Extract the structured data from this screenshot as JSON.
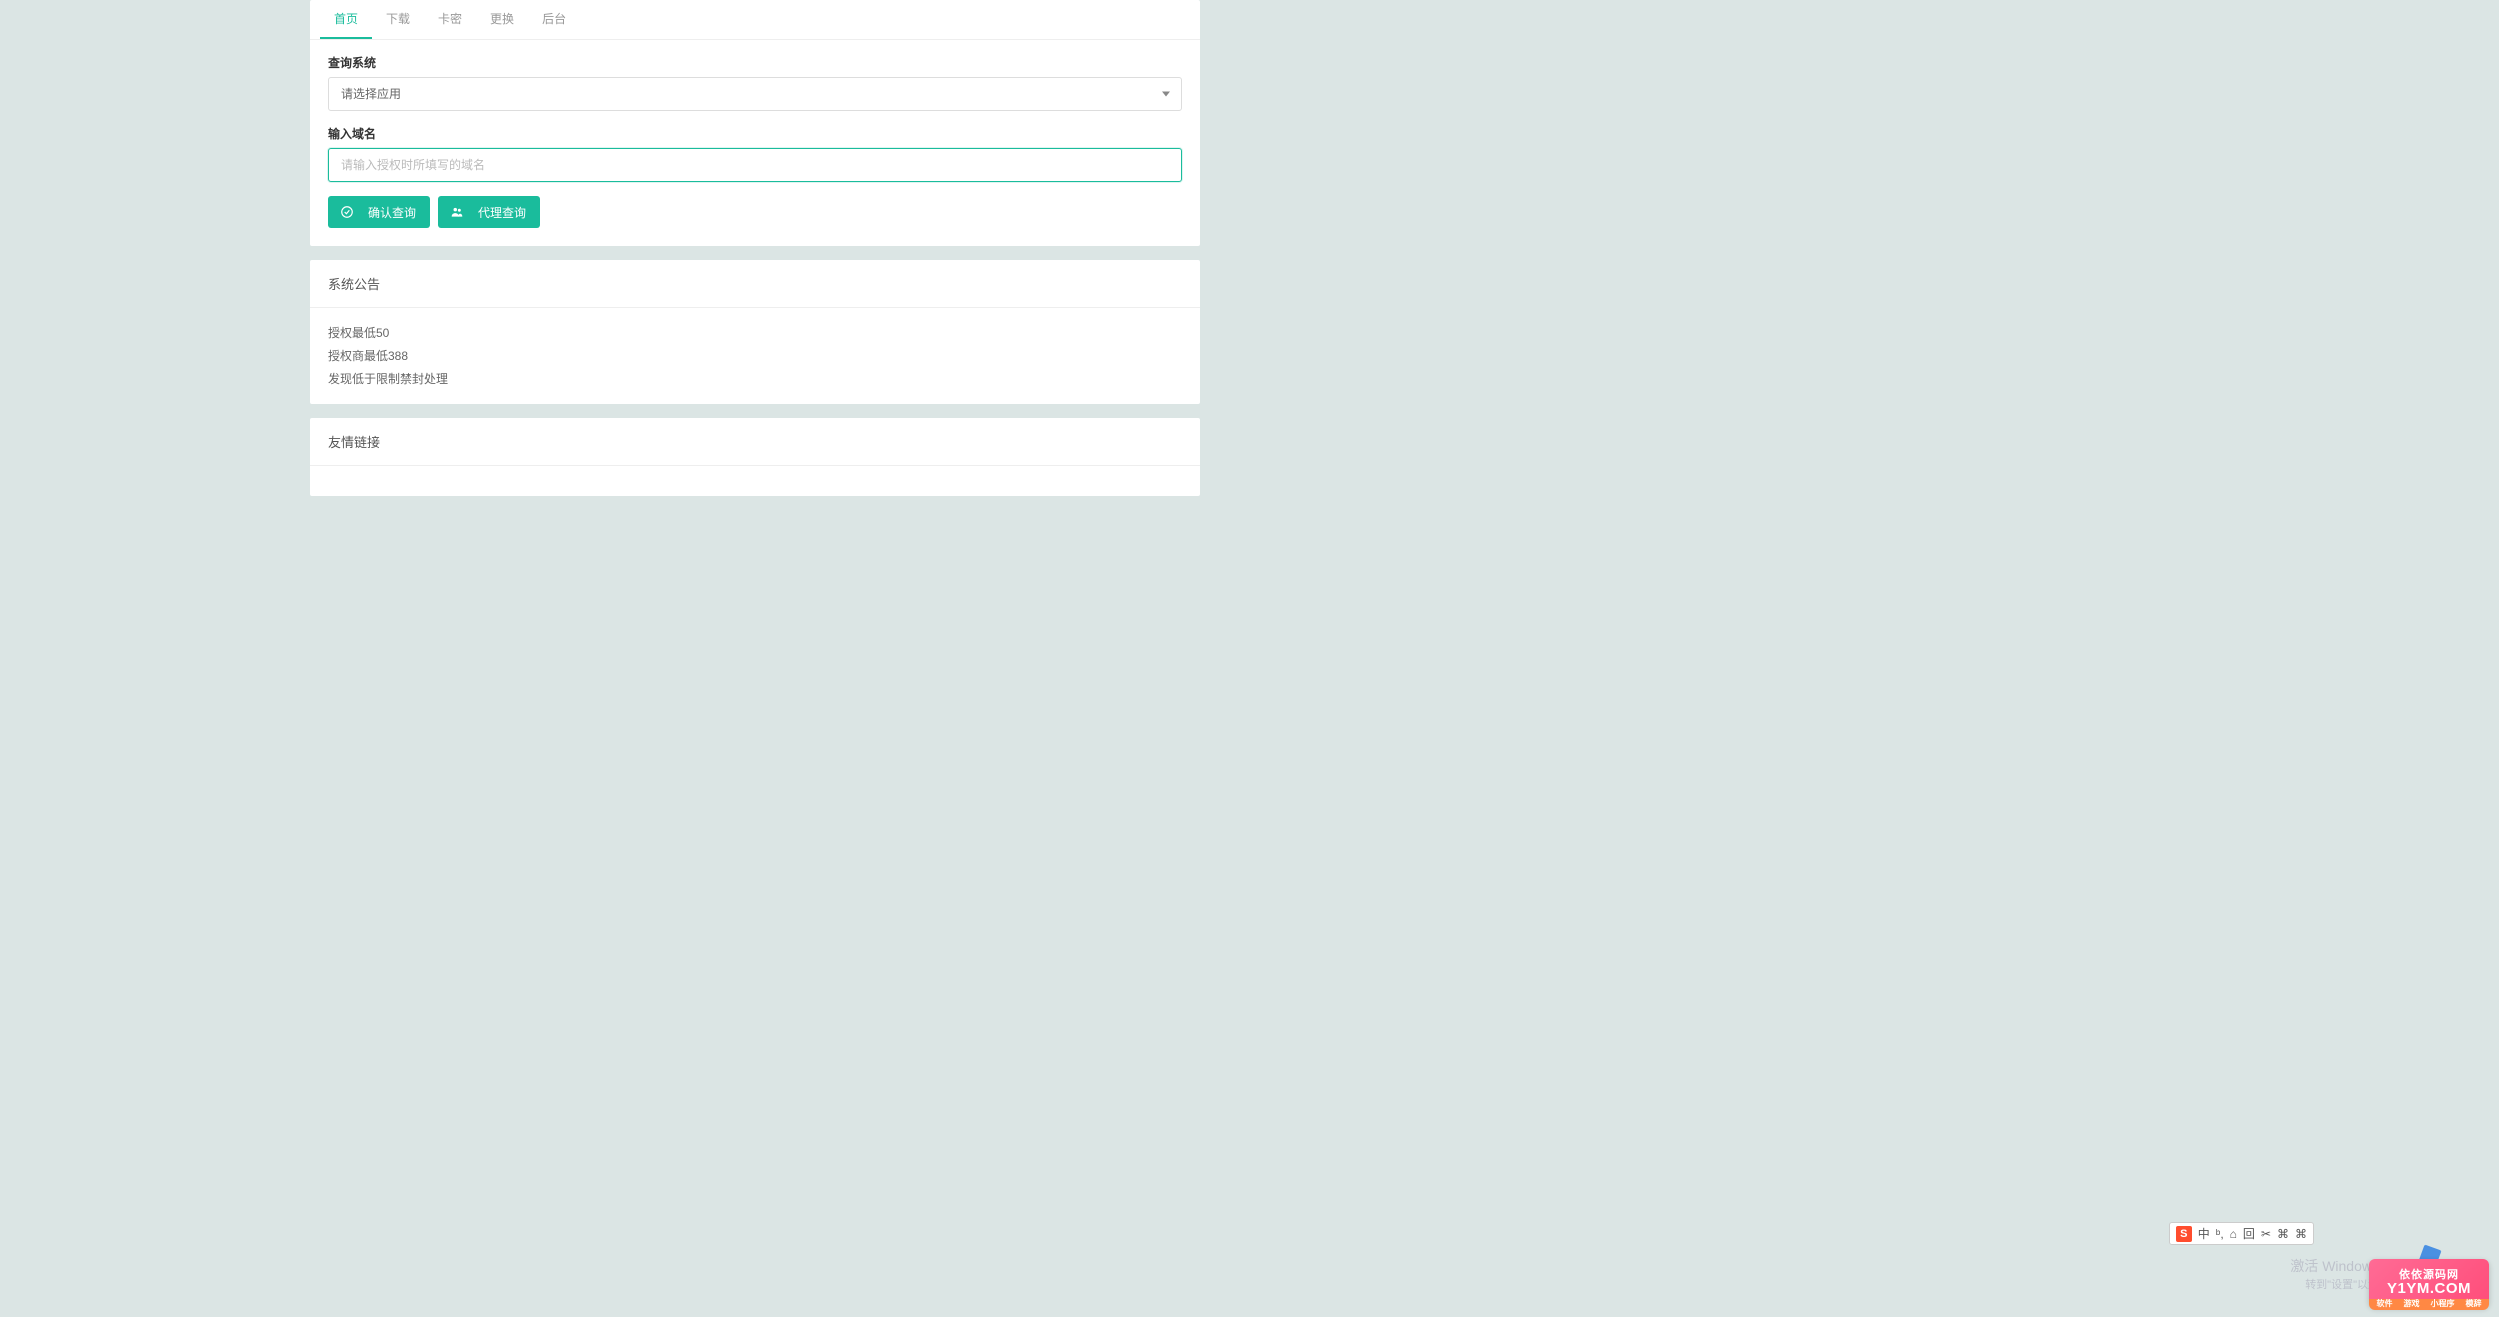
{
  "tabs": {
    "items": [
      "首页",
      "下载",
      "卡密",
      "更换",
      "后台"
    ],
    "active_index": 0
  },
  "form": {
    "system_label": "查询系统",
    "select_placeholder": "请选择应用",
    "domain_label": "输入域名",
    "domain_placeholder": "请输入授权时所填写的域名",
    "confirm_btn": "确认查询",
    "agent_btn": "代理查询"
  },
  "announcement": {
    "title": "系统公告",
    "lines": [
      "授权最低50",
      "授权商最低388",
      "发现低于限制禁封处理"
    ]
  },
  "links": {
    "title": "友情链接"
  },
  "watermark": {
    "title": "激活 Windows",
    "sub": "转到\"设置\"以激"
  },
  "ime": {
    "logo": "S",
    "items": [
      "中",
      "ᵇ,",
      "⌂",
      "回",
      "✂",
      "⌘",
      "⌘"
    ]
  },
  "badge": {
    "top": "依依源码网",
    "main": "Y1YM.COM",
    "tags": [
      "软件",
      "游戏",
      "小程序",
      "模辞"
    ]
  }
}
